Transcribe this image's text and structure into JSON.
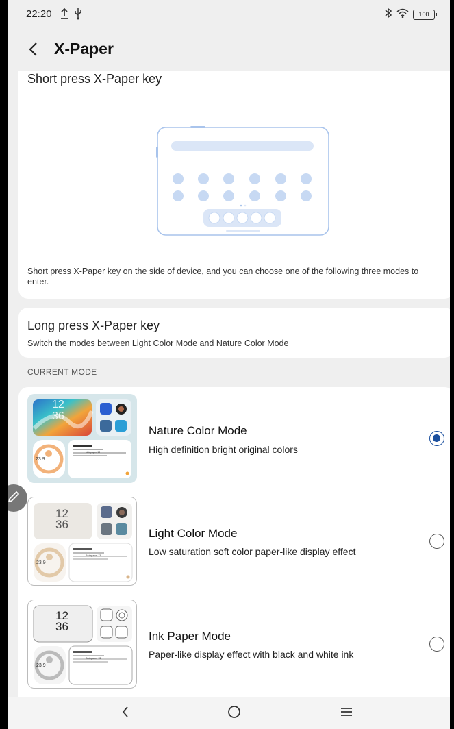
{
  "status_bar": {
    "time": "22:20",
    "battery": "100",
    "icons": [
      "upload-icon",
      "usb-icon",
      "bluetooth-icon",
      "wifi-icon",
      "battery-icon"
    ]
  },
  "app_bar": {
    "back_icon": "chevron-left-icon",
    "title": "X-Paper"
  },
  "short_press": {
    "title": "Short press X-Paper key",
    "description": "Short press X-Paper key on the side of device, and you can choose one of the following three modes to enter."
  },
  "long_press": {
    "title": "Long press X-Paper key",
    "description": "Switch the modes between Light Color Mode and Nature Color Mode"
  },
  "current_mode_label": "CURRENT MODE",
  "modes": [
    {
      "name": "Nature Color Mode",
      "description": "High definition bright original colors",
      "selected": true,
      "thumb": {
        "hour": "12",
        "minute": "36",
        "temp": "23.9",
        "card_title": "Notepaper 13"
      }
    },
    {
      "name": "Light Color Mode",
      "description": "Low saturation soft color paper-like display effect",
      "selected": false,
      "thumb": {
        "hour": "12",
        "minute": "36",
        "temp": "23.9",
        "card_title": "Notepaper 13"
      }
    },
    {
      "name": "Ink Paper Mode",
      "description": "Paper-like display effect with black and white ink",
      "selected": false,
      "thumb": {
        "hour": "12",
        "minute": "36",
        "temp": "23.9",
        "card_title": "Notepaper 13"
      }
    }
  ],
  "nav_bar": {
    "back": "triangle-back-icon",
    "home": "circle-home-icon",
    "menu": "hamburger-menu-icon"
  },
  "colors": {
    "accent": "#1a4f9e",
    "illustration_stroke": "#a9c4ec",
    "illustration_fill": "#dbe6f7"
  }
}
